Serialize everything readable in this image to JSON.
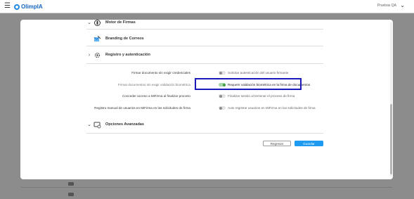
{
  "header": {
    "menu_icon": "hamburger-icon",
    "logo_text": "OlimpIA",
    "user_name": "Pruebas QA",
    "chevron_icon": "chevron-down-icon"
  },
  "sections": [
    {
      "title": "Motor de Firmas",
      "state": "expanded",
      "icon": "signature-engine-icon"
    },
    {
      "title": "Branding de Correos",
      "state": "none",
      "icon": "mail-branding-icon"
    },
    {
      "title": "Registro y autenticación",
      "state": "collapsed",
      "icon": "registration-gear-icon"
    },
    {
      "title": "Opciones Avanzadas",
      "state": "expanded",
      "icon": "advanced-options-icon"
    }
  ],
  "settings": [
    {
      "label": "Firmar documento sin exigir credenciales",
      "enabled": false,
      "description": "Solicitar autenticación del usuario firmante"
    },
    {
      "label": "Firmar documentos sin exigir validación biométrica",
      "enabled": true,
      "description": "Requerir validación biométrica en la firma de documentos"
    },
    {
      "label": "Conceder acceso a MiFirma al finalizar proceso",
      "enabled": false,
      "description": "Finalizar sesión al terminar el proceso de firma"
    },
    {
      "label": "Registro manual de usuarios en MiFirma en las solicitudes de firma",
      "enabled": false,
      "description": "Auto registrar usuarios en MiFirma en las solicitudes de firma"
    }
  ],
  "buttons": {
    "back": "Regresar",
    "save": "Guardar"
  },
  "colors": {
    "brand": "#1565c0",
    "toggle_on": "#43a047",
    "save_button": "#1e9bf0",
    "highlight": "#1a1ab8"
  }
}
